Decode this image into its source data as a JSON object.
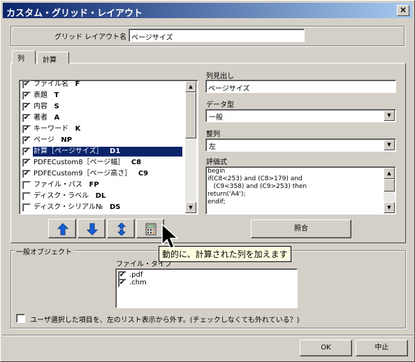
{
  "window": {
    "title": "カスタム・グリッド・レイアウト",
    "close_glyph": "×"
  },
  "layout_name": {
    "label": "グリッド レイアウト名",
    "value": "ページサイズ"
  },
  "tabs": [
    {
      "label": "列",
      "active": true
    },
    {
      "label": "計算",
      "active": false
    }
  ],
  "columns_list": [
    {
      "label": "ファイル名",
      "code": "F",
      "checked": true,
      "selected": false
    },
    {
      "label": "表題",
      "code": "T",
      "checked": true,
      "selected": false
    },
    {
      "label": "内容",
      "code": "S",
      "checked": true,
      "selected": false
    },
    {
      "label": "著者",
      "code": "A",
      "checked": true,
      "selected": false
    },
    {
      "label": "キーワード",
      "code": "K",
      "checked": true,
      "selected": false
    },
    {
      "label": "ページ",
      "code": "NP",
      "checked": true,
      "selected": false
    },
    {
      "label": "計算［ページサイズ］",
      "code": "D1",
      "checked": true,
      "selected": true
    },
    {
      "label": "PDFECustom8［ページ幅］",
      "code": "C8",
      "checked": true,
      "selected": false
    },
    {
      "label": "PDFECustom9［ページ高さ］",
      "code": "C9",
      "checked": true,
      "selected": false
    },
    {
      "label": "ファイル・パス",
      "code": "FP",
      "checked": false,
      "selected": false
    },
    {
      "label": "ディスク・ラベル",
      "code": "DL",
      "checked": false,
      "selected": false
    },
    {
      "label": "ディスク・シリアル№",
      "code": "DS",
      "checked": false,
      "selected": false
    }
  ],
  "list_buttons": [
    {
      "name": "move-up-button",
      "icon": "arrow-up-icon"
    },
    {
      "name": "move-down-button",
      "icon": "arrow-down-icon"
    },
    {
      "name": "swap-button",
      "icon": "up-down-arrows-icon"
    },
    {
      "name": "add-calculated-column-button",
      "icon": "calculator-icon"
    }
  ],
  "tooltip": "動的に、計算された列を加えます",
  "properties": {
    "header_label": "列見出し",
    "header_value": "ページサイズ",
    "datatype_label": "データ型",
    "datatype_value": "一般",
    "align_label": "整列",
    "align_value": "左",
    "formula_label": "評価式",
    "formula_value": "begin\nif(C8<253) and (C8>179) and\n   (C9<358) and (C9>253) then\nreturn('A4');\nendif;",
    "verify_button": "照合"
  },
  "general_objects": {
    "group_label": "一般オブジェクト",
    "filetype_label": "ファイル・タイプ",
    "filetypes": [
      {
        "label": ".pdf",
        "checked": true
      },
      {
        "label": ".chm",
        "checked": true
      }
    ],
    "exclude_label": "ユーザ選択した項目を、左のリスト表示から外す。(チェックしなくても外れている？)",
    "exclude_checked": false
  },
  "footer": {
    "ok": "OK",
    "cancel": "中止"
  },
  "colors": {
    "title_gradient_start": "#0a246a",
    "title_gradient_end": "#a6caf0",
    "selection": "#0a246a",
    "arrow_blue": "#1a5fd8",
    "tooltip_bg": "#ffffe1"
  }
}
